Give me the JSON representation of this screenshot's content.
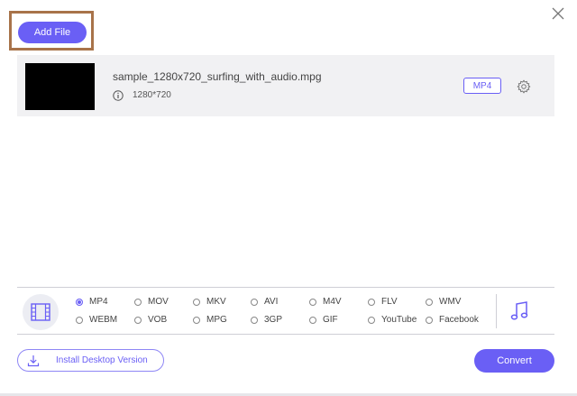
{
  "toolbar": {
    "add_file_label": "Add File"
  },
  "file": {
    "name": "sample_1280x720_surfing_with_audio.mpg",
    "resolution": "1280*720",
    "output_format": "MP4"
  },
  "formats": {
    "row1": [
      "MP4",
      "MOV",
      "MKV",
      "AVI",
      "M4V",
      "FLV",
      "WMV"
    ],
    "row2": [
      "WEBM",
      "VOB",
      "MPG",
      "3GP",
      "GIF",
      "YouTube",
      "Facebook"
    ],
    "selected": "MP4"
  },
  "footer": {
    "install_label": "Install Desktop Version",
    "convert_label": "Convert"
  },
  "colors": {
    "accent": "#6a5ff5",
    "highlight": "#a8734a"
  },
  "icons": [
    "close-icon",
    "info-icon",
    "gear-icon",
    "film-icon",
    "music-icon",
    "download-icon"
  ]
}
